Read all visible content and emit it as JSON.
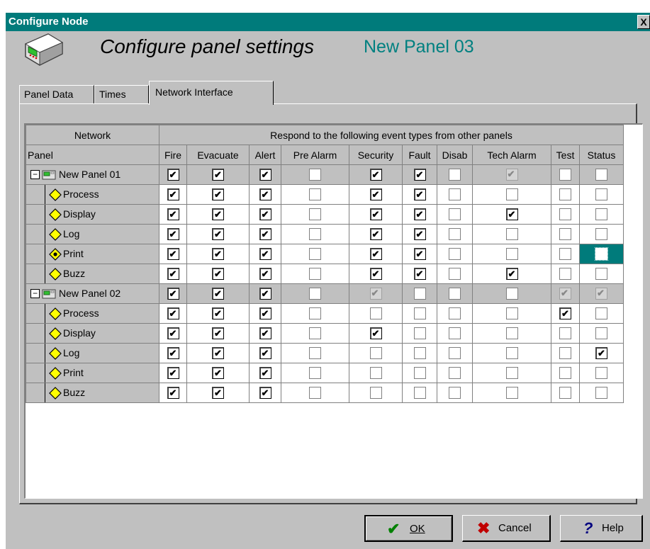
{
  "window": {
    "title": "Configure Node",
    "close_glyph": "X"
  },
  "header": {
    "text": "Configure panel settings",
    "panel_name": "New Panel 03"
  },
  "tabs": [
    {
      "label": "Panel Data",
      "active": false
    },
    {
      "label": "Times",
      "active": false
    },
    {
      "label": "Network Interface",
      "active": true
    }
  ],
  "grid": {
    "header_row1": {
      "network": "Network",
      "respond": "Respond to the following event types from other panels"
    },
    "panel_label": "Panel",
    "columns": [
      "Fire",
      "Evacuate",
      "Alert",
      "Pre Alarm",
      "Security",
      "Fault",
      "Disab",
      "Tech Alarm",
      "Test",
      "Status"
    ],
    "groups": [
      {
        "name": "New Panel 01",
        "expander": "−",
        "row": [
          1,
          1,
          1,
          0,
          1,
          1,
          0,
          2,
          0,
          0
        ],
        "children": [
          {
            "name": "Process",
            "row": [
              1,
              1,
              1,
              0,
              1,
              1,
              0,
              0,
              0,
              0
            ]
          },
          {
            "name": "Display",
            "row": [
              1,
              1,
              1,
              0,
              1,
              1,
              0,
              1,
              0,
              0
            ]
          },
          {
            "name": "Log",
            "row": [
              1,
              1,
              1,
              0,
              1,
              1,
              0,
              0,
              0,
              0
            ]
          },
          {
            "name": "Print",
            "row": [
              1,
              1,
              1,
              0,
              1,
              1,
              0,
              0,
              0,
              0
            ],
            "selected_col": 9
          },
          {
            "name": "Buzz",
            "row": [
              1,
              1,
              1,
              0,
              1,
              1,
              0,
              1,
              0,
              0
            ]
          }
        ]
      },
      {
        "name": "New Panel 02",
        "expander": "−",
        "row": [
          1,
          1,
          1,
          0,
          2,
          0,
          0,
          0,
          2,
          2
        ],
        "children": [
          {
            "name": "Process",
            "row": [
              1,
              1,
              1,
              0,
              0,
              0,
              0,
              0,
              1,
              0
            ]
          },
          {
            "name": "Display",
            "row": [
              1,
              1,
              1,
              0,
              1,
              0,
              0,
              0,
              0,
              0
            ]
          },
          {
            "name": "Log",
            "row": [
              1,
              1,
              1,
              0,
              0,
              0,
              0,
              0,
              0,
              1
            ]
          },
          {
            "name": "Print",
            "row": [
              1,
              1,
              1,
              0,
              0,
              0,
              0,
              0,
              0,
              0
            ]
          },
          {
            "name": "Buzz",
            "row": [
              1,
              1,
              1,
              0,
              0,
              0,
              0,
              0,
              0,
              0
            ]
          }
        ]
      }
    ]
  },
  "buttons": {
    "ok": {
      "label": "OK",
      "icon": "checkmark-icon",
      "color": "#008000"
    },
    "cancel": {
      "label": "Cancel",
      "icon": "x-icon",
      "color": "#c00000"
    },
    "help": {
      "label": "Help",
      "icon": "question-icon",
      "color": "#000080"
    }
  }
}
